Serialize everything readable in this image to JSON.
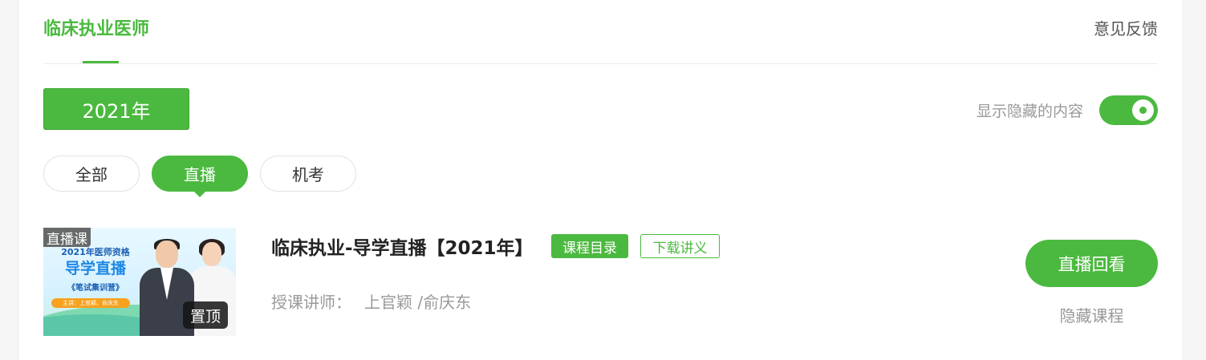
{
  "header": {
    "title": "临床执业医师",
    "feedback_label": "意见反馈"
  },
  "year_filter": {
    "selected": "2021年"
  },
  "hidden_toggle": {
    "label": "显示隐藏的内容",
    "on": true
  },
  "tabs": [
    {
      "label": "全部",
      "active": false
    },
    {
      "label": "直播",
      "active": true
    },
    {
      "label": "机考",
      "active": false
    }
  ],
  "course": {
    "thumbnail": {
      "badge": "直播课",
      "pin_label": "置顶",
      "line1": "2021年医师资格",
      "line2": "导学直播",
      "line3": "《笔试集训营》",
      "line4": "主讲：上官颖、俞庆东"
    },
    "title": "临床执业-导学直播【2021年】",
    "catalog_label": "课程目录",
    "download_label": "下载讲义",
    "teacher_label": "授课讲师：",
    "teacher_names": "上官颖 /俞庆东",
    "replay_label": "直播回看",
    "hide_label": "隐藏课程"
  },
  "colors": {
    "accent": "#4bb93f",
    "muted_text": "#999999",
    "title_text": "#222222"
  }
}
